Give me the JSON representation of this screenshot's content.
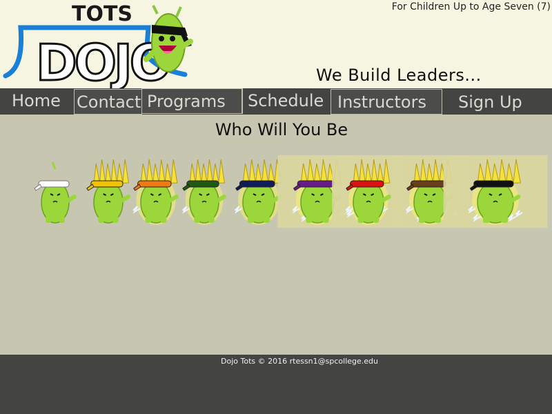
{
  "header": {
    "logo_top_text": "TOTS",
    "logo_main_text": "DOJO",
    "age_note": "For Children Up to Age Seven (7)",
    "slogan": "We Build Leaders..."
  },
  "nav": {
    "items": [
      {
        "label": "Home"
      },
      {
        "label": "Contact"
      },
      {
        "label": "Programs"
      },
      {
        "label": "Schedule"
      },
      {
        "label": "Instructors"
      },
      {
        "label": "Sign Up"
      }
    ]
  },
  "main": {
    "headline": "Who Will You Be",
    "belts": [
      {
        "color": "#ffffff",
        "name": "white-belt",
        "power": 0
      },
      {
        "color": "#f2c200",
        "name": "yellow-belt",
        "power": 0
      },
      {
        "color": "#f07a10",
        "name": "orange-belt",
        "power": 1
      },
      {
        "color": "#1f5a12",
        "name": "green-belt",
        "power": 1
      },
      {
        "color": "#101c5a",
        "name": "blue-belt",
        "power": 1
      },
      {
        "color": "#6a1a8a",
        "name": "purple-belt",
        "power": 2
      },
      {
        "color": "#e01010",
        "name": "red-belt",
        "power": 2
      },
      {
        "color": "#6a3e1a",
        "name": "brown-belt",
        "power": 2
      },
      {
        "color": "#111111",
        "name": "black-belt",
        "power": 3
      }
    ]
  },
  "footer": {
    "text": "Dojo Tots © 2016 rtessn1@spcollege.edu"
  },
  "colors": {
    "header_bg": "#f5f5e1",
    "nav_bg": "#444543",
    "body_bg": "#c6c6b1",
    "character_green": "#9bd63a",
    "logo_blue": "#1a7fd6"
  }
}
